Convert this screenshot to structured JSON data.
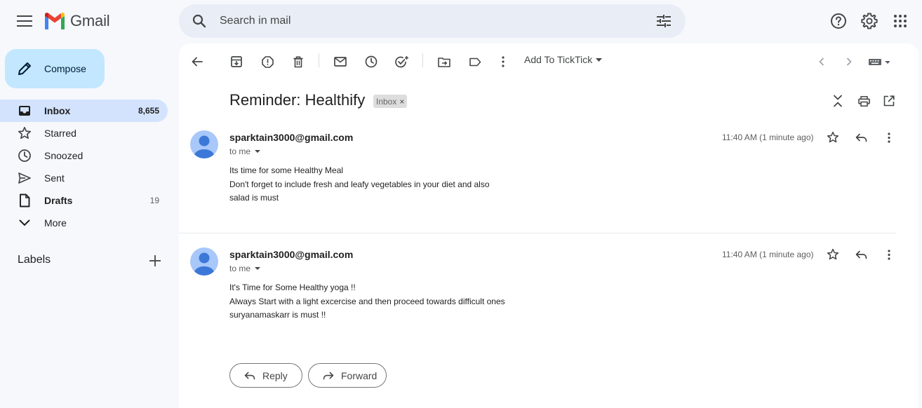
{
  "app": {
    "name": "Gmail"
  },
  "search": {
    "placeholder": "Search in mail"
  },
  "compose": {
    "label": "Compose"
  },
  "sidebar": {
    "items": [
      {
        "label": "Inbox",
        "count": "8,655"
      },
      {
        "label": "Starred",
        "count": ""
      },
      {
        "label": "Snoozed",
        "count": ""
      },
      {
        "label": "Sent",
        "count": ""
      },
      {
        "label": "Drafts",
        "count": "19"
      },
      {
        "label": "More",
        "count": ""
      }
    ],
    "labels_header": "Labels"
  },
  "toolbar": {
    "ticktick_label": "Add To TickTick"
  },
  "thread": {
    "subject": "Reminder: Healthify",
    "chip": "Inbox",
    "chip_close": "×",
    "messages": [
      {
        "sender": "sparktain3000@gmail.com",
        "to": "to me",
        "time": "11:40 AM (1 minute ago)",
        "lines": [
          "Its time for some Healthy Meal",
          "Don't forget  to include fresh and leafy vegetables  in your diet and also",
          "salad is must"
        ]
      },
      {
        "sender": "sparktain3000@gmail.com",
        "to": "to me",
        "time": "11:40 AM (1 minute ago)",
        "lines": [
          "It's Time for Some Healthy yoga !!",
          "Always Start with a light excercise and then proceed towards difficult ones",
          "suryanamaskarr is must !!"
        ]
      }
    ],
    "reply_label": "Reply",
    "forward_label": "Forward"
  },
  "colors": {
    "background": "#f6f8fc",
    "compose_bg": "#c2e7ff",
    "active_nav_bg": "#d3e3fd",
    "avatar_bg": "#a8c7fa",
    "avatar_fg": "#3c78d8"
  }
}
